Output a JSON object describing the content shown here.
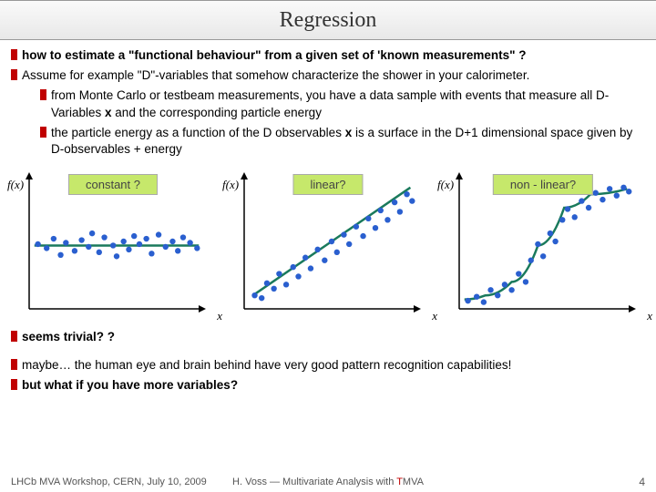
{
  "title": "Regression",
  "bullets": {
    "b1": "how to estimate a \"functional behaviour\" from a given set of 'known measurements\" ?",
    "b2": "Assume for example \"D\"-variables that somehow characterize the shower in your calorimeter.",
    "b2a_pre": "from Monte Carlo or testbeam measurements, you have a data sample with events that measure all D-Variables ",
    "b2a_x": "x",
    "b2a_post": " and the corresponding particle energy",
    "b2b_pre": "the particle energy as a function of the D observables ",
    "b2b_x": "x",
    "b2b_post": " is a surface in the D+1 dimensional space given by D-observables + energy",
    "b3": "seems trivial? ?",
    "b4": "maybe… the human eye and brain behind have very good pattern recognition capabilities!",
    "b5": "but what if you have more variables?"
  },
  "chart_tags": {
    "c1": "constant ?",
    "c2": "linear?",
    "c3": "non - linear?"
  },
  "axis": {
    "y": "f(x)",
    "x": "x"
  },
  "footer": {
    "left": "LHCb MVA Workshop, CERN, July 10, 2009",
    "center_pre": "H. Voss ― Multivariate Analysis with ",
    "center_t": "T",
    "center_post": "MVA",
    "page": "4"
  },
  "chart_data": [
    {
      "type": "scatter",
      "title": "constant ?",
      "xlabel": "x",
      "ylabel": "f(x)",
      "xlim": [
        0,
        10
      ],
      "ylim": [
        0,
        10
      ],
      "fit": {
        "kind": "constant",
        "y": 4.7
      },
      "points": [
        [
          0.5,
          4.8
        ],
        [
          1.0,
          4.5
        ],
        [
          1.4,
          5.2
        ],
        [
          1.8,
          4.0
        ],
        [
          2.1,
          4.9
        ],
        [
          2.6,
          4.3
        ],
        [
          3.0,
          5.1
        ],
        [
          3.4,
          4.6
        ],
        [
          3.6,
          5.6
        ],
        [
          4.0,
          4.2
        ],
        [
          4.3,
          5.3
        ],
        [
          4.8,
          4.7
        ],
        [
          5.0,
          3.9
        ],
        [
          5.4,
          5.0
        ],
        [
          5.7,
          4.4
        ],
        [
          6.0,
          5.4
        ],
        [
          6.3,
          4.8
        ],
        [
          6.7,
          5.2
        ],
        [
          7.0,
          4.1
        ],
        [
          7.4,
          5.5
        ],
        [
          7.8,
          4.6
        ],
        [
          8.2,
          5.0
        ],
        [
          8.5,
          4.3
        ],
        [
          8.8,
          5.3
        ],
        [
          9.2,
          4.9
        ],
        [
          9.6,
          4.5
        ]
      ]
    },
    {
      "type": "scatter",
      "title": "linear?",
      "xlabel": "x",
      "ylabel": "f(x)",
      "xlim": [
        0,
        10
      ],
      "ylim": [
        0,
        10
      ],
      "fit": {
        "kind": "linear",
        "x0": 0.5,
        "y0": 1.0,
        "x1": 9.5,
        "y1": 9.0
      },
      "points": [
        [
          0.6,
          1.0
        ],
        [
          1.0,
          0.8
        ],
        [
          1.3,
          1.9
        ],
        [
          1.7,
          1.5
        ],
        [
          2.0,
          2.6
        ],
        [
          2.4,
          1.8
        ],
        [
          2.8,
          3.1
        ],
        [
          3.1,
          2.4
        ],
        [
          3.5,
          3.8
        ],
        [
          3.8,
          3.0
        ],
        [
          4.2,
          4.4
        ],
        [
          4.6,
          3.6
        ],
        [
          5.0,
          5.0
        ],
        [
          5.3,
          4.2
        ],
        [
          5.7,
          5.5
        ],
        [
          6.0,
          4.8
        ],
        [
          6.4,
          6.1
        ],
        [
          6.8,
          5.4
        ],
        [
          7.1,
          6.7
        ],
        [
          7.5,
          6.0
        ],
        [
          7.8,
          7.3
        ],
        [
          8.2,
          6.6
        ],
        [
          8.6,
          7.9
        ],
        [
          8.9,
          7.2
        ],
        [
          9.3,
          8.5
        ],
        [
          9.6,
          8.0
        ]
      ]
    },
    {
      "type": "scatter",
      "title": "non - linear?",
      "xlabel": "x",
      "ylabel": "f(x)",
      "xlim": [
        0,
        10
      ],
      "ylim": [
        0,
        10
      ],
      "fit": {
        "kind": "sigmoid",
        "path": [
          [
            0.3,
            0.7
          ],
          [
            1.5,
            1.0
          ],
          [
            3,
            2.0
          ],
          [
            4.5,
            4.7
          ],
          [
            6,
            7.5
          ],
          [
            7.5,
            8.5
          ],
          [
            9.6,
            8.9
          ]
        ]
      },
      "points": [
        [
          0.5,
          0.6
        ],
        [
          1.0,
          0.9
        ],
        [
          1.4,
          0.5
        ],
        [
          1.8,
          1.4
        ],
        [
          2.2,
          1.0
        ],
        [
          2.6,
          1.8
        ],
        [
          3.0,
          1.4
        ],
        [
          3.4,
          2.6
        ],
        [
          3.8,
          2.0
        ],
        [
          4.1,
          3.6
        ],
        [
          4.5,
          4.8
        ],
        [
          4.8,
          3.9
        ],
        [
          5.2,
          5.6
        ],
        [
          5.5,
          5.0
        ],
        [
          5.9,
          6.6
        ],
        [
          6.2,
          7.4
        ],
        [
          6.6,
          6.8
        ],
        [
          7.0,
          8.0
        ],
        [
          7.4,
          7.5
        ],
        [
          7.8,
          8.6
        ],
        [
          8.2,
          8.1
        ],
        [
          8.6,
          8.9
        ],
        [
          9.0,
          8.4
        ],
        [
          9.4,
          9.0
        ],
        [
          9.7,
          8.7
        ]
      ]
    }
  ]
}
